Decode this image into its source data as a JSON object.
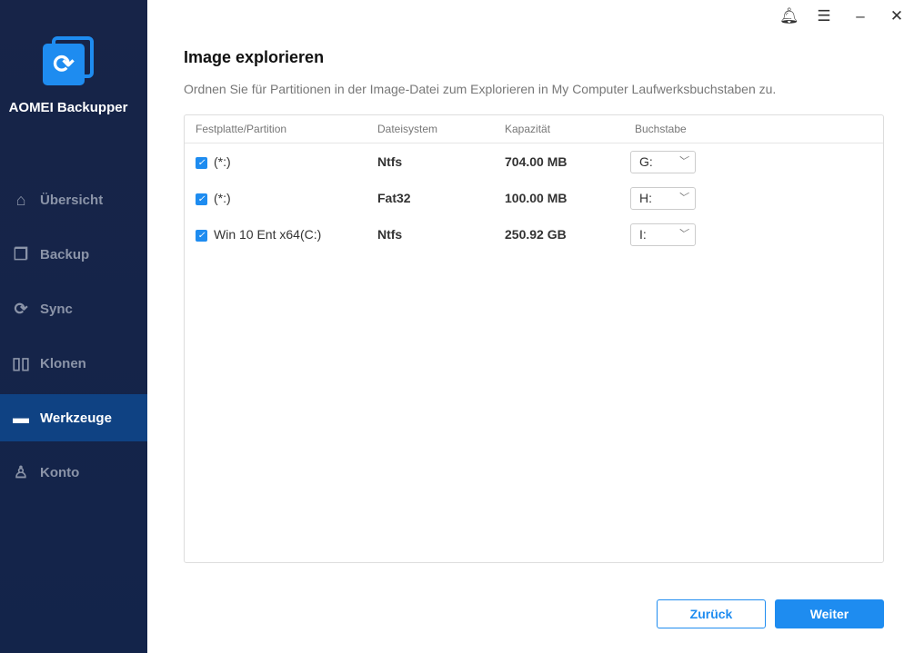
{
  "app": {
    "name": "AOMEI Backupper"
  },
  "sidebar": {
    "items": [
      {
        "label": "Übersicht",
        "icon": "home-icon"
      },
      {
        "label": "Backup",
        "icon": "backup-icon"
      },
      {
        "label": "Sync",
        "icon": "sync-icon"
      },
      {
        "label": "Klonen",
        "icon": "clone-icon"
      },
      {
        "label": "Werkzeuge",
        "icon": "toolbox-icon",
        "active": true
      },
      {
        "label": "Konto",
        "icon": "user-icon"
      }
    ]
  },
  "page": {
    "title": "Image explorieren",
    "description": "Ordnen Sie für Partitionen in der Image-Datei zum Explorieren in My Computer Laufwerksbuchstaben zu."
  },
  "table": {
    "headers": [
      "Festplatte/Partition",
      "Dateisystem",
      "Kapazität",
      "Buchstabe"
    ],
    "rows": [
      {
        "checked": true,
        "partition": "(*:)",
        "fs": "Ntfs",
        "capacity": "704.00 MB",
        "letter": "G:"
      },
      {
        "checked": true,
        "partition": "(*:)",
        "fs": "Fat32",
        "capacity": "100.00 MB",
        "letter": "H:"
      },
      {
        "checked": true,
        "partition": "Win 10 Ent x64(C:)",
        "fs": "Ntfs",
        "capacity": "250.92 GB",
        "letter": "I:"
      }
    ]
  },
  "buttons": {
    "back": "Zurück",
    "next": "Weiter"
  },
  "colors": {
    "accent": "#1e8cf0",
    "sidebar": "#15234a",
    "active": "#0f4283"
  }
}
